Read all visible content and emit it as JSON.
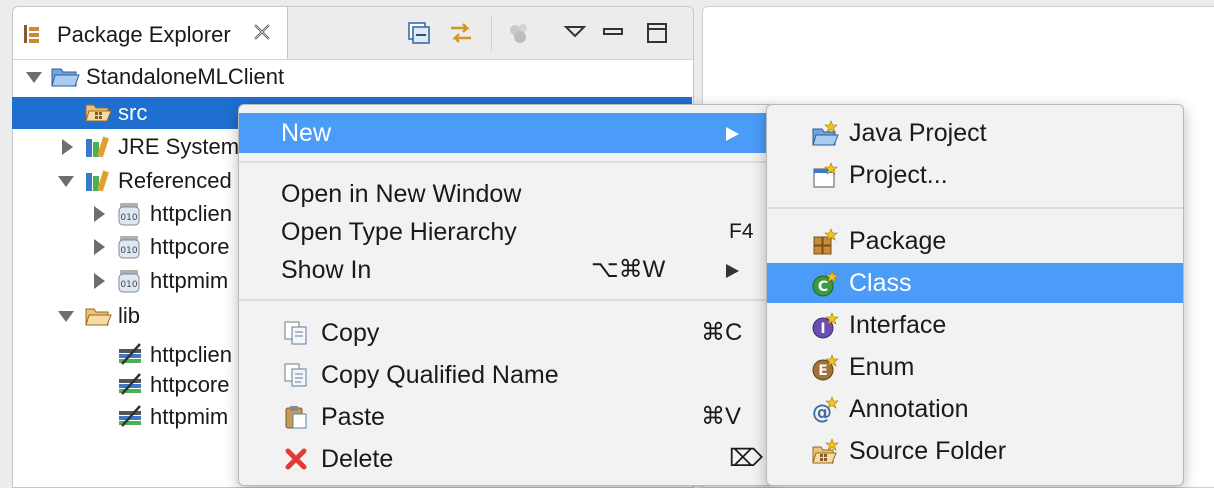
{
  "view": {
    "title": "Package Explorer",
    "toolbar": [
      "collapse-all-icon",
      "link-with-editor-icon",
      "focus-icon",
      "view-menu-icon",
      "minimize-icon",
      "maximize-icon"
    ]
  },
  "tree": {
    "project": "StandaloneMLClient",
    "src": "src",
    "jre": "JRE System",
    "referenced": "Referenced",
    "ref_items": [
      "httpclien",
      "httpcore",
      "httpmim"
    ],
    "lib": "lib",
    "lib_items": [
      "httpclien",
      "httpcore",
      "httpmim"
    ]
  },
  "context_menu": {
    "new": "New",
    "open_new_window": "Open in New Window",
    "open_type_hierarchy": "Open Type Hierarchy",
    "open_type_hierarchy_shortcut": "F4",
    "show_in": "Show In",
    "show_in_shortcut": "⌥⌘W",
    "copy": "Copy",
    "copy_shortcut": "⌘C",
    "copy_qualified": "Copy Qualified Name",
    "paste": "Paste",
    "paste_shortcut": "⌘V",
    "delete": "Delete",
    "delete_shortcut": "⌦"
  },
  "new_submenu": {
    "java_project": "Java Project",
    "project": "Project...",
    "package": "Package",
    "class": "Class",
    "interface": "Interface",
    "enum": "Enum",
    "annotation": "Annotation",
    "source_folder": "Source Folder"
  },
  "colors": {
    "selection": "#1f6fd1",
    "menu_highlight": "#4a9cf8"
  }
}
